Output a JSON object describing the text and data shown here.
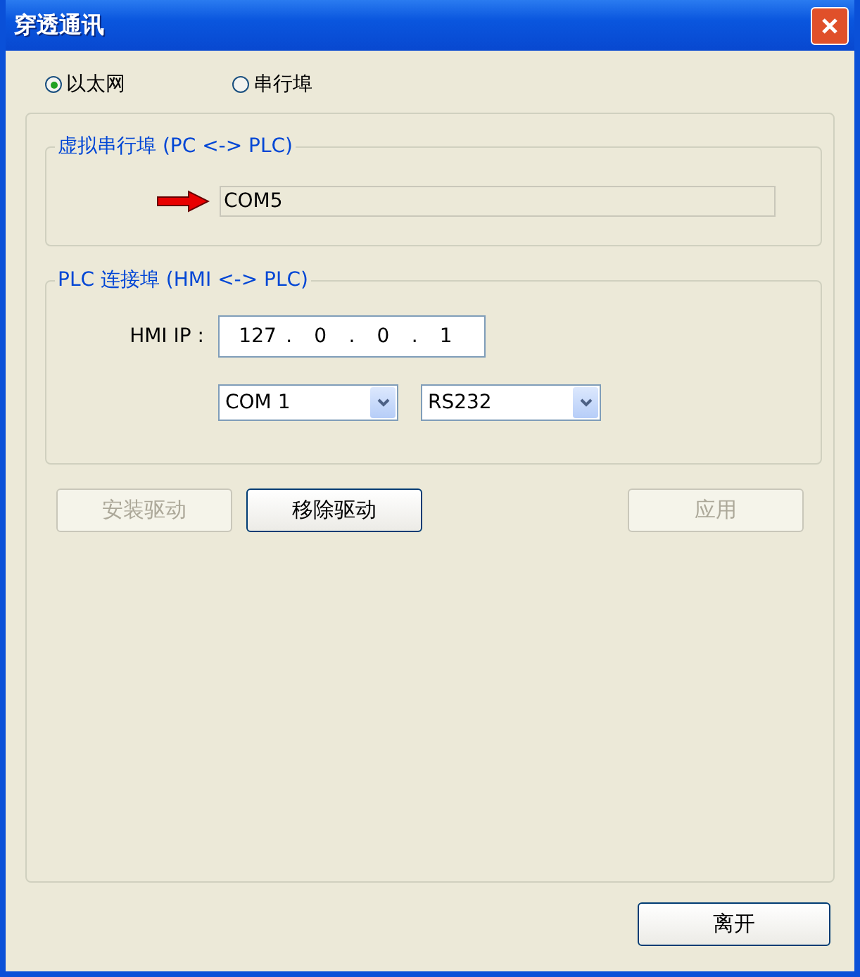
{
  "window": {
    "title": "穿透通讯"
  },
  "radios": [
    {
      "label": "以太网",
      "selected": true
    },
    {
      "label": "串行埠",
      "selected": false
    }
  ],
  "virtual_port": {
    "title": "虚拟串行埠 (PC <-> PLC)",
    "value": "COM5"
  },
  "plc_port": {
    "title": "PLC 连接埠 (HMI <-> PLC)",
    "ip_label": "HMI IP :",
    "ip_parts": [
      {
        "kind": "octet",
        "text": "127"
      },
      {
        "kind": "dot",
        "text": "."
      },
      {
        "kind": "octet",
        "text": "0"
      },
      {
        "kind": "dot",
        "text": "."
      },
      {
        "kind": "octet",
        "text": "0"
      },
      {
        "kind": "dot",
        "text": "."
      },
      {
        "kind": "octet",
        "text": "1"
      }
    ],
    "selects": [
      {
        "value": "COM 1"
      },
      {
        "value": "RS232"
      }
    ]
  },
  "buttons": [
    {
      "label": "安装驱动",
      "disabled": true
    },
    {
      "label": "移除驱动",
      "disabled": false
    },
    {
      "label": "应用",
      "disabled": true
    }
  ],
  "exit_button": {
    "label": "离开"
  }
}
